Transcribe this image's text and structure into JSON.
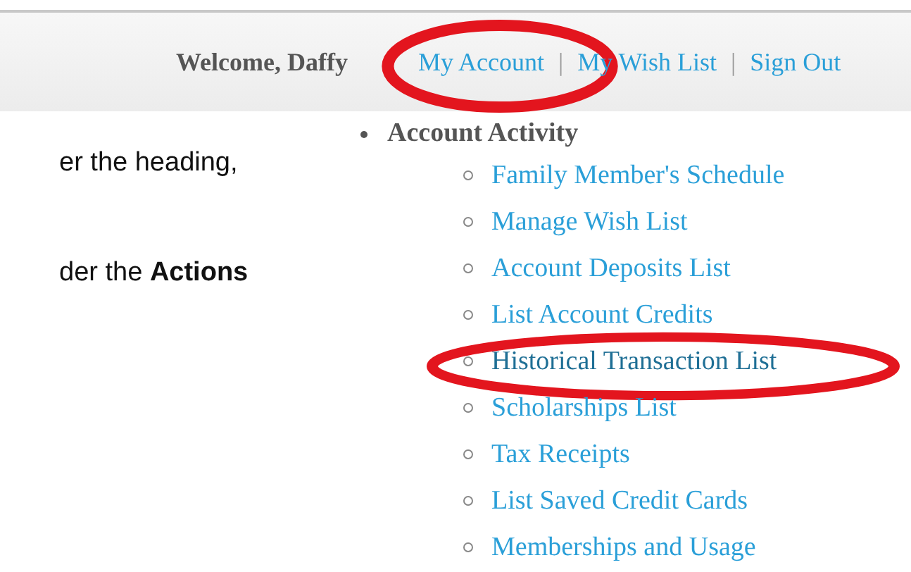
{
  "header": {
    "welcome": "Welcome, Daffy",
    "links": [
      {
        "label": "My Account",
        "highlighted": true
      },
      {
        "label": "My Wish List",
        "highlighted": false
      },
      {
        "label": "Sign Out",
        "highlighted": false
      }
    ],
    "separator": "|"
  },
  "document_lines": [
    "er the heading,",
    "der the **Actions**"
  ],
  "menu": {
    "heading": "Account Activity",
    "items": [
      {
        "label": "Family Member's Schedule",
        "highlighted": false
      },
      {
        "label": "Manage Wish List",
        "highlighted": false
      },
      {
        "label": "Account Deposits List",
        "highlighted": false
      },
      {
        "label": "List Account Credits",
        "highlighted": false
      },
      {
        "label": "Historical Transaction List",
        "highlighted": true
      },
      {
        "label": "Scholarships List",
        "highlighted": false
      },
      {
        "label": "Tax Receipts",
        "highlighted": false
      },
      {
        "label": "List Saved Credit Cards",
        "highlighted": false
      },
      {
        "label": "Memberships and Usage",
        "highlighted": false
      }
    ]
  }
}
